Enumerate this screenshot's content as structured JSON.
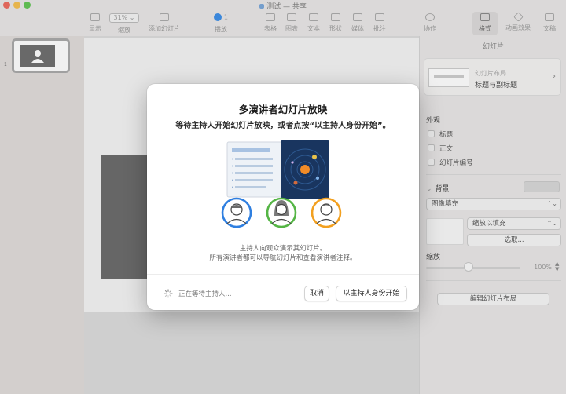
{
  "window": {
    "title": "测试",
    "title_suffix": "— 共享"
  },
  "toolbar": {
    "items": [
      {
        "label": "显示",
        "icon": "sidebar-icon"
      },
      {
        "label": "缩放",
        "value": "31%",
        "icon": "zoom-menu"
      },
      {
        "label": "添加幻灯片",
        "icon": "add-slide-icon"
      },
      {
        "label": "播放",
        "value": "1",
        "icon": "play-icon"
      },
      {
        "label": "表格",
        "icon": "table-icon"
      },
      {
        "label": "图表",
        "icon": "chart-icon"
      },
      {
        "label": "文本",
        "icon": "text-icon"
      },
      {
        "label": "形状",
        "icon": "shape-icon"
      },
      {
        "label": "媒体",
        "icon": "media-icon"
      },
      {
        "label": "批注",
        "icon": "comment-icon"
      },
      {
        "label": "协作",
        "icon": "collaborate-icon"
      },
      {
        "label": "格式",
        "icon": "format-icon"
      },
      {
        "label": "动画效果",
        "icon": "animate-icon"
      },
      {
        "label": "文稿",
        "icon": "document-icon"
      }
    ]
  },
  "navigator": {
    "slide_number": "1"
  },
  "inspector": {
    "title": "幻灯片",
    "layout_label": "幻灯片布局",
    "layout_value": "标题与副标题",
    "appearance_header": "外观",
    "checkboxes": [
      "标题",
      "正文",
      "幻灯片编号"
    ],
    "background_header": "背景",
    "fill_select": "图像填充",
    "scale_select": "缩放以填充",
    "choose_button": "选取...",
    "zoom_label": "缩放",
    "zoom_value": "100%",
    "edit_layout_button": "编辑幻灯片布局"
  },
  "modal": {
    "title": "多演讲者幻灯片放映",
    "subtitle": "等待主持人开始幻灯片放映，或者点按“以主持人身份开始”。",
    "desc_line1": "主持人向观众演示其幻灯片。",
    "desc_line2": "所有演讲者都可以导航幻灯片和查看演讲者注释。",
    "waiting_text": "正在等待主持人...",
    "cancel_label": "取消",
    "start_label": "以主持人身份开始"
  },
  "colors": {
    "accent_blue": "#2f7fe0",
    "accent_green": "#55b545",
    "accent_orange": "#f2a020",
    "modal_bg": "#ffffff"
  }
}
